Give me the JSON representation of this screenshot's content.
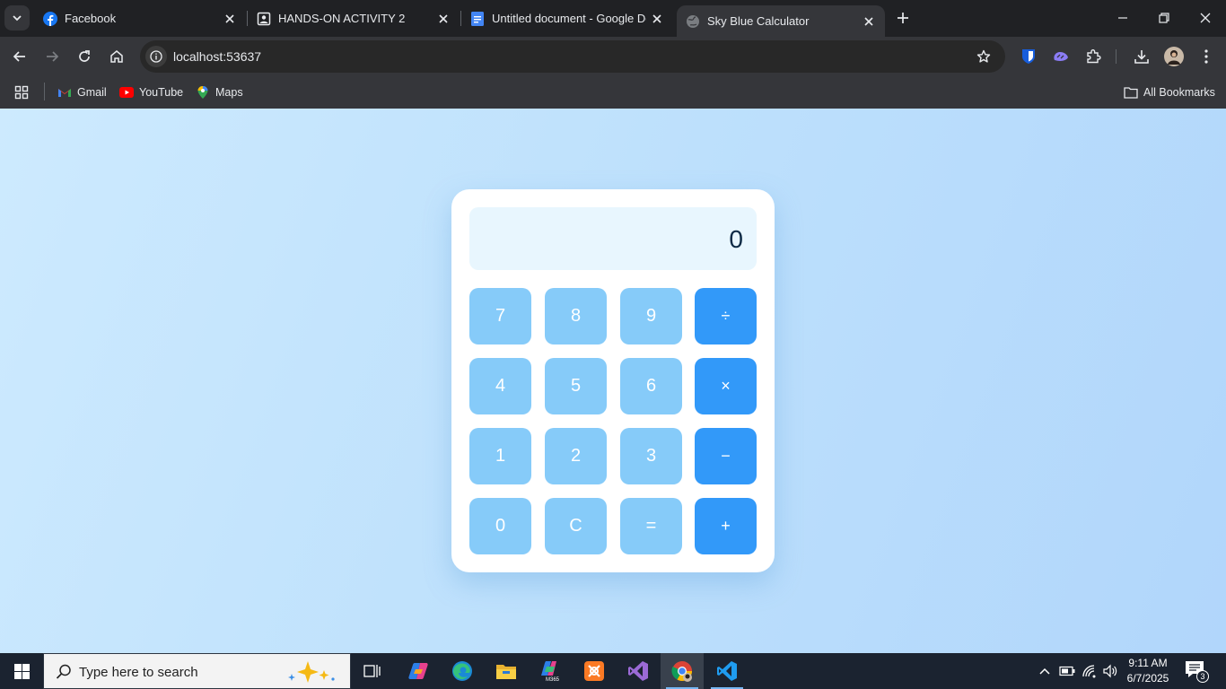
{
  "browser": {
    "tabs": [
      {
        "title": "Facebook",
        "icon": "facebook-icon",
        "active": false
      },
      {
        "title": "HANDS-ON ACTIVITY 2",
        "icon": "portrait-icon",
        "active": false
      },
      {
        "title": "Untitled document - Google Docs",
        "icon": "google-docs-icon",
        "active": false
      },
      {
        "title": "Sky Blue Calculator",
        "icon": "globe-icon",
        "active": true
      }
    ],
    "address": "localhost:53637",
    "bookmarks": [
      {
        "label": "Gmail",
        "icon": "gmail-icon"
      },
      {
        "label": "YouTube",
        "icon": "youtube-icon"
      },
      {
        "label": "Maps",
        "icon": "maps-icon"
      }
    ],
    "all_bookmarks_label": "All Bookmarks"
  },
  "calculator": {
    "display": "0",
    "keys": [
      {
        "label": "7",
        "type": "num"
      },
      {
        "label": "8",
        "type": "num"
      },
      {
        "label": "9",
        "type": "num"
      },
      {
        "label": "÷",
        "type": "op"
      },
      {
        "label": "4",
        "type": "num"
      },
      {
        "label": "5",
        "type": "num"
      },
      {
        "label": "6",
        "type": "num"
      },
      {
        "label": "×",
        "type": "op"
      },
      {
        "label": "1",
        "type": "num"
      },
      {
        "label": "2",
        "type": "num"
      },
      {
        "label": "3",
        "type": "num"
      },
      {
        "label": "−",
        "type": "op"
      },
      {
        "label": "0",
        "type": "num"
      },
      {
        "label": "C",
        "type": "num"
      },
      {
        "label": "=",
        "type": "num"
      },
      {
        "label": "+",
        "type": "op"
      }
    ],
    "colors": {
      "number_key": "#86cbf9",
      "operator_key": "#3299f9",
      "display_bg": "#e8f6fe"
    }
  },
  "taskbar": {
    "search_placeholder": "Type here to search",
    "apps": [
      "task-view-icon",
      "copilot-icon",
      "edge-icon",
      "file-explorer-icon",
      "microsoft-365-icon",
      "xampp-icon",
      "visual-studio-icon",
      "chrome-icon",
      "vscode-icon"
    ],
    "time": "9:11 AM",
    "date": "6/7/2025",
    "notification_count": "3"
  }
}
